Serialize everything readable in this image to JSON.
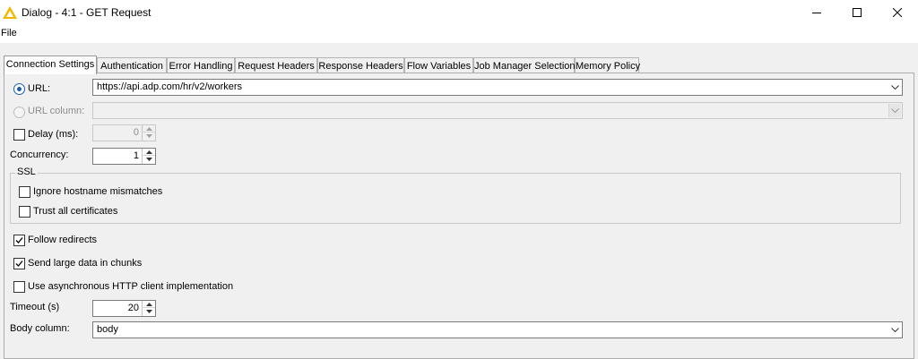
{
  "window": {
    "title": "Dialog - 4:1 - GET Request",
    "app_icon": "knime-warning-triangle-icon",
    "controls": [
      "minimize-icon",
      "maximize-icon",
      "close-icon"
    ]
  },
  "menu": {
    "file_label": "File"
  },
  "tabs": [
    {
      "label": "Connection Settings",
      "active": true
    },
    {
      "label": "Authentication"
    },
    {
      "label": "Error Handling"
    },
    {
      "label": "Request Headers"
    },
    {
      "label": "Response Headers"
    },
    {
      "label": "Flow Variables"
    },
    {
      "label": "Job Manager Selection"
    },
    {
      "label": "Memory Policy"
    }
  ],
  "form": {
    "url_label": "URL:",
    "url_value": "https://api.adp.com/hr/v2/workers",
    "url_selected": true,
    "url_column_label": "URL column:",
    "url_column_value": "",
    "delay_label": "Delay (ms):",
    "delay_checked": false,
    "delay_value": "0",
    "concurrency_label": "Concurrency:",
    "concurrency_value": "1",
    "ssl_title": "SSL",
    "ignore_hostname_label": "Ignore hostname mismatches",
    "ignore_hostname_checked": false,
    "trust_all_label": "Trust all certificates",
    "trust_all_checked": false,
    "follow_redirects_label": "Follow redirects",
    "follow_redirects_checked": true,
    "send_chunks_label": "Send large data in chunks",
    "send_chunks_checked": true,
    "async_label": "Use asynchronous HTTP client implementation",
    "async_checked": false,
    "timeout_label": "Timeout (s)",
    "timeout_value": "20",
    "body_column_label": "Body column:",
    "body_column_value": "body"
  },
  "colors": {
    "accent": "#1a5fb4",
    "app_icon": "#f2b800"
  }
}
